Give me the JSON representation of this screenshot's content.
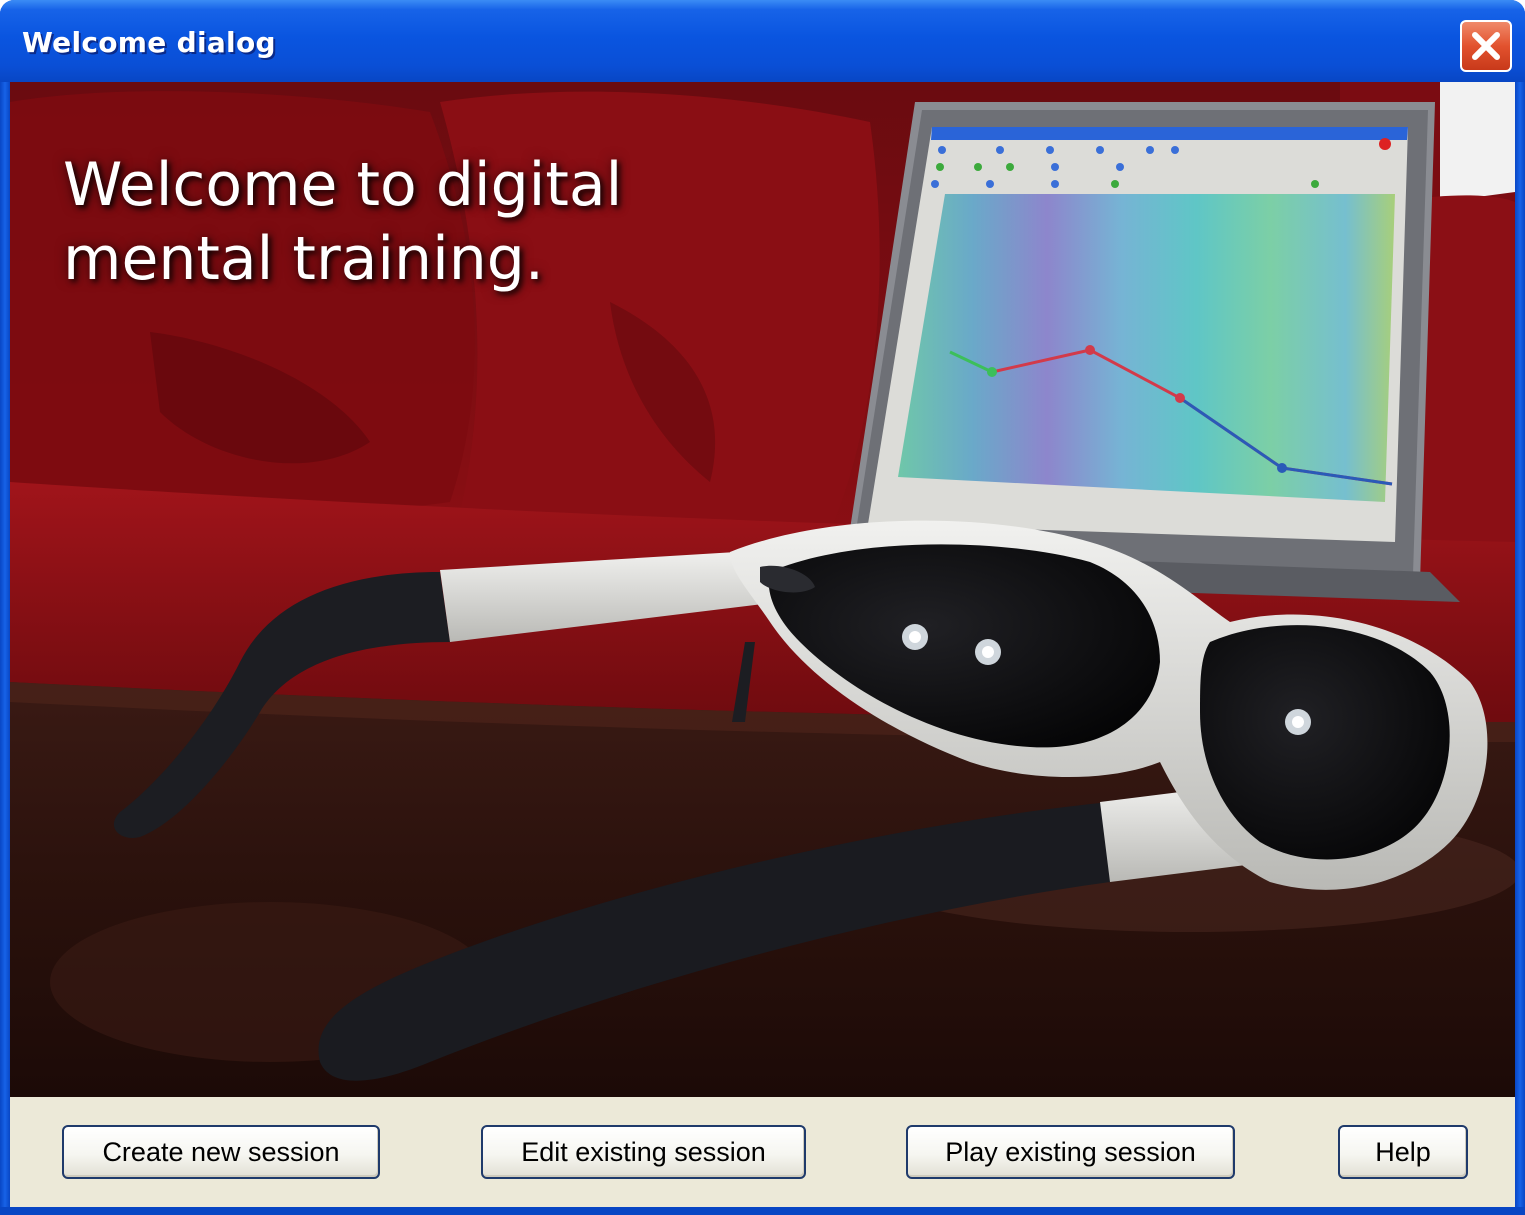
{
  "window": {
    "title": "Welcome dialog",
    "close_icon": "close-icon"
  },
  "hero": {
    "heading_line1": "Welcome to digital",
    "heading_line2": "mental training."
  },
  "buttons": {
    "create": "Create new session",
    "edit": "Edit existing session",
    "play": "Play existing session",
    "help": "Help"
  },
  "colors": {
    "titlebar": "#0a55e0",
    "close_button": "#e2522e",
    "dialog_background": "#ece9d8",
    "sofa_red": "#8f0d12"
  }
}
